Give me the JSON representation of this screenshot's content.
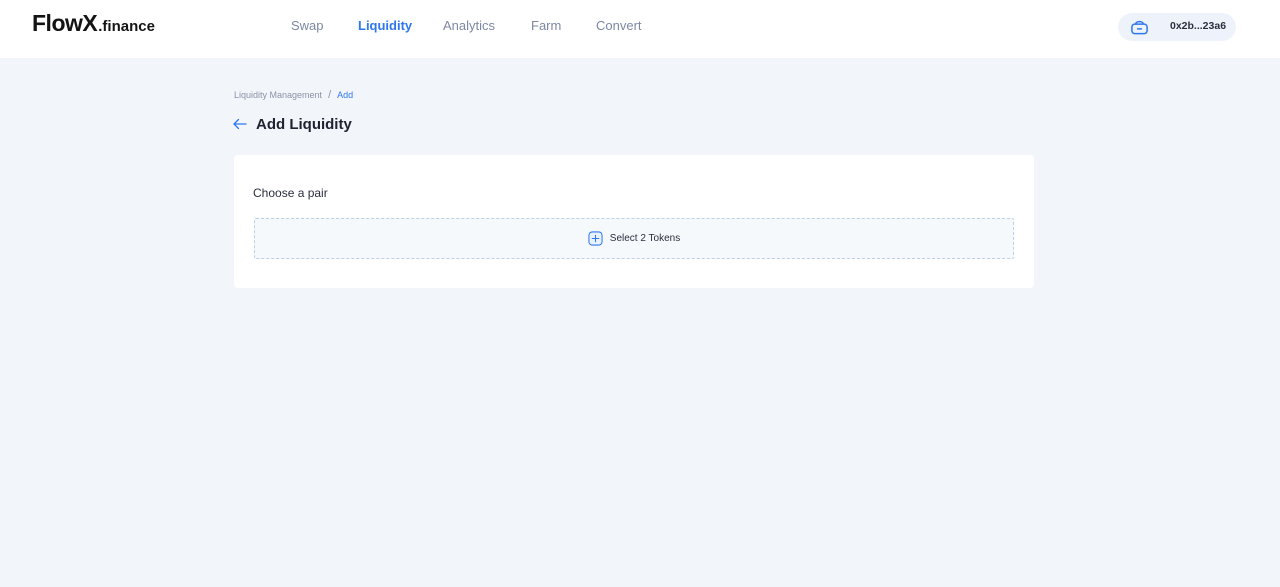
{
  "header": {
    "logo": {
      "main": "FlowX",
      "sub": ".finance"
    },
    "nav": [
      {
        "label": "Swap",
        "active": false
      },
      {
        "label": "Liquidity",
        "active": true
      },
      {
        "label": "Analytics",
        "active": false
      },
      {
        "label": "Farm",
        "active": false
      },
      {
        "label": "Convert",
        "active": false
      }
    ],
    "wallet": {
      "icon": "wallet-bag-icon",
      "address": "0x2b...23a6"
    }
  },
  "breadcrumb": {
    "root": "Liquidity Management",
    "separator": "/",
    "current": "Add"
  },
  "page": {
    "title": "Add Liquidity",
    "back_icon": "arrow-left-icon"
  },
  "card": {
    "label": "Choose a pair",
    "select_button": {
      "icon": "plus-square-icon",
      "label": "Select 2 Tokens"
    }
  },
  "colors": {
    "accent": "#2f77ef",
    "page_bg": "#f2f5fa",
    "nav_inactive": "#7d88a3",
    "dashed_border": "#bcd0ea"
  }
}
